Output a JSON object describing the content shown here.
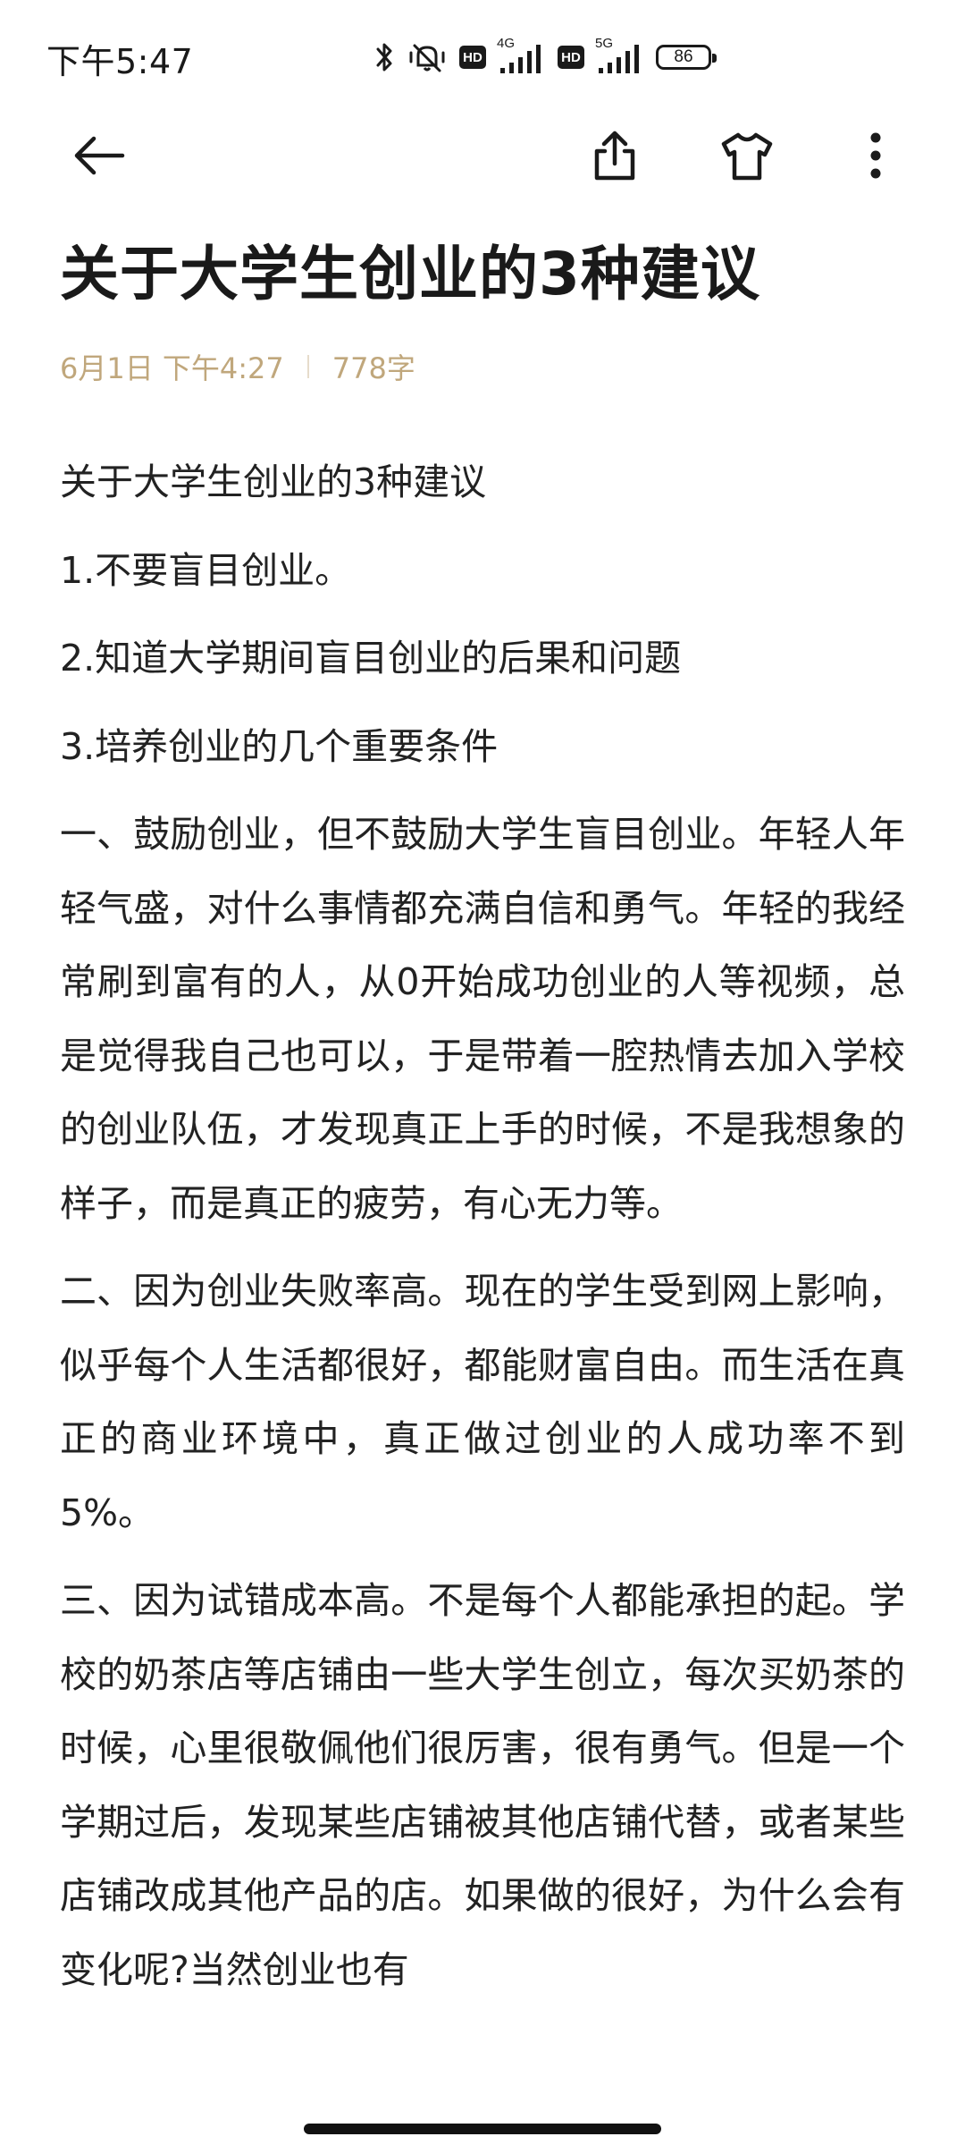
{
  "status_bar": {
    "time": "下午5:47",
    "net1": "4G",
    "net2": "5G",
    "hd": "HD",
    "battery": "86"
  },
  "toolbar": {
    "back_icon": "arrow-left-icon",
    "share_icon": "share-icon",
    "theme_icon": "tshirt-icon",
    "more_icon": "more-vertical-icon"
  },
  "article": {
    "title": "关于大学生创业的3种建议",
    "date": "6月1日 下午4:27",
    "word_count": "778字",
    "paragraphs": [
      "关于大学生创业的3种建议",
      "1.不要盲目创业。",
      "2.知道大学期间盲目创业的后果和问题",
      "3.培养创业的几个重要条件",
      "一、鼓励创业，但不鼓励大学生盲目创业。年轻人年轻气盛，对什么事情都充满自信和勇气。年轻的我经常刷到富有的人，从0开始成功创业的人等视频，总是觉得我自己也可以，于是带着一腔热情去加入学校的创业队伍，才发现真正上手的时候，不是我想象的样子，而是真正的疲劳，有心无力等。",
      "二、因为创业失败率高。现在的学生受到网上影响，似乎每个人生活都很好，都能财富自由。而生活在真正的商业环境中，真正做过创业的人成功率不到5%。",
      "三、因为试错成本高。不是每个人都能承担的起。学校的奶茶店等店铺由一些大学生创立，每次买奶茶的时候，心里很敬佩他们很厉害，很有勇气。但是一个学期过后，发现某些店铺被其他店铺代替，或者某些店铺改成其他产品的店。如果做的很好，为什么会有变化呢?当然创业也有"
    ]
  },
  "colors": {
    "meta": "#c0a77c",
    "text": "#222222",
    "background": "#ffffff"
  }
}
